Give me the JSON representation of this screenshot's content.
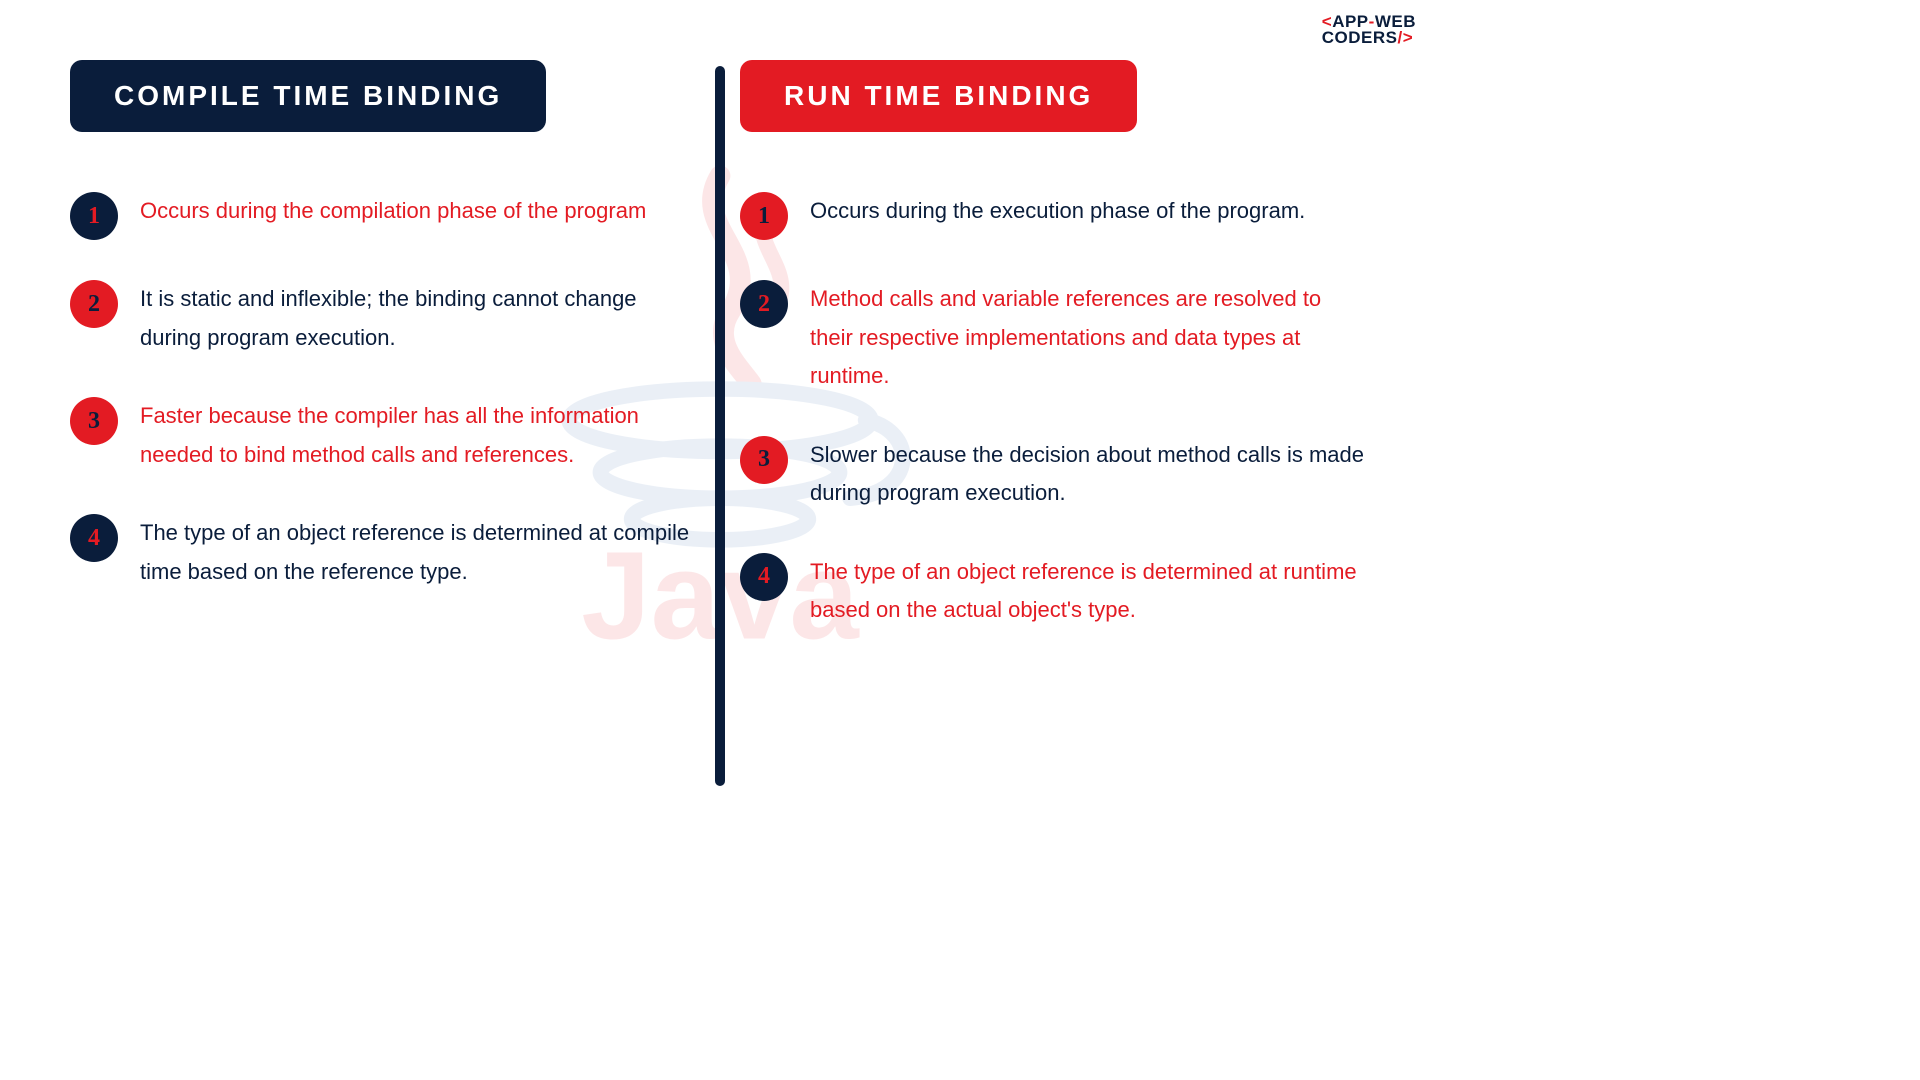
{
  "brand": {
    "top_prefix": "<",
    "top_main": "APP",
    "top_dash": "-",
    "top_tail": "WEB",
    "bot_main": "CODERS",
    "bot_slash": "/",
    "bot_gt": ">"
  },
  "left": {
    "title": "COMPILE TIME BINDING",
    "items": [
      {
        "num": "1",
        "text": "Occurs during the compilation phase of the program",
        "badge": "navy",
        "color": "red"
      },
      {
        "num": "2",
        "text": "It is static and inflexible; the binding cannot change during program execution.",
        "badge": "red",
        "color": "navy"
      },
      {
        "num": "3",
        "text": "Faster because the compiler has all the information needed to bind method calls and references.",
        "badge": "red",
        "color": "red"
      },
      {
        "num": "4",
        "text": "The type of an object reference is determined at compile time based on the reference type.",
        "badge": "navy",
        "color": "navy"
      }
    ]
  },
  "right": {
    "title": "RUN TIME BINDING",
    "items": [
      {
        "num": "1",
        "text": "Occurs during the execution phase of the program.",
        "badge": "red",
        "color": "navy"
      },
      {
        "num": "2",
        "text": "Method calls and variable references are resolved to their respective implementations and data types at runtime.",
        "badge": "navy",
        "color": "red"
      },
      {
        "num": "3",
        "text": "Slower because the decision about method calls is made during program execution.",
        "badge": "red",
        "color": "navy"
      },
      {
        "num": "4",
        "text": "The type of an object reference is determined at runtime based on the actual object's type.",
        "badge": "navy",
        "color": "red"
      }
    ]
  }
}
